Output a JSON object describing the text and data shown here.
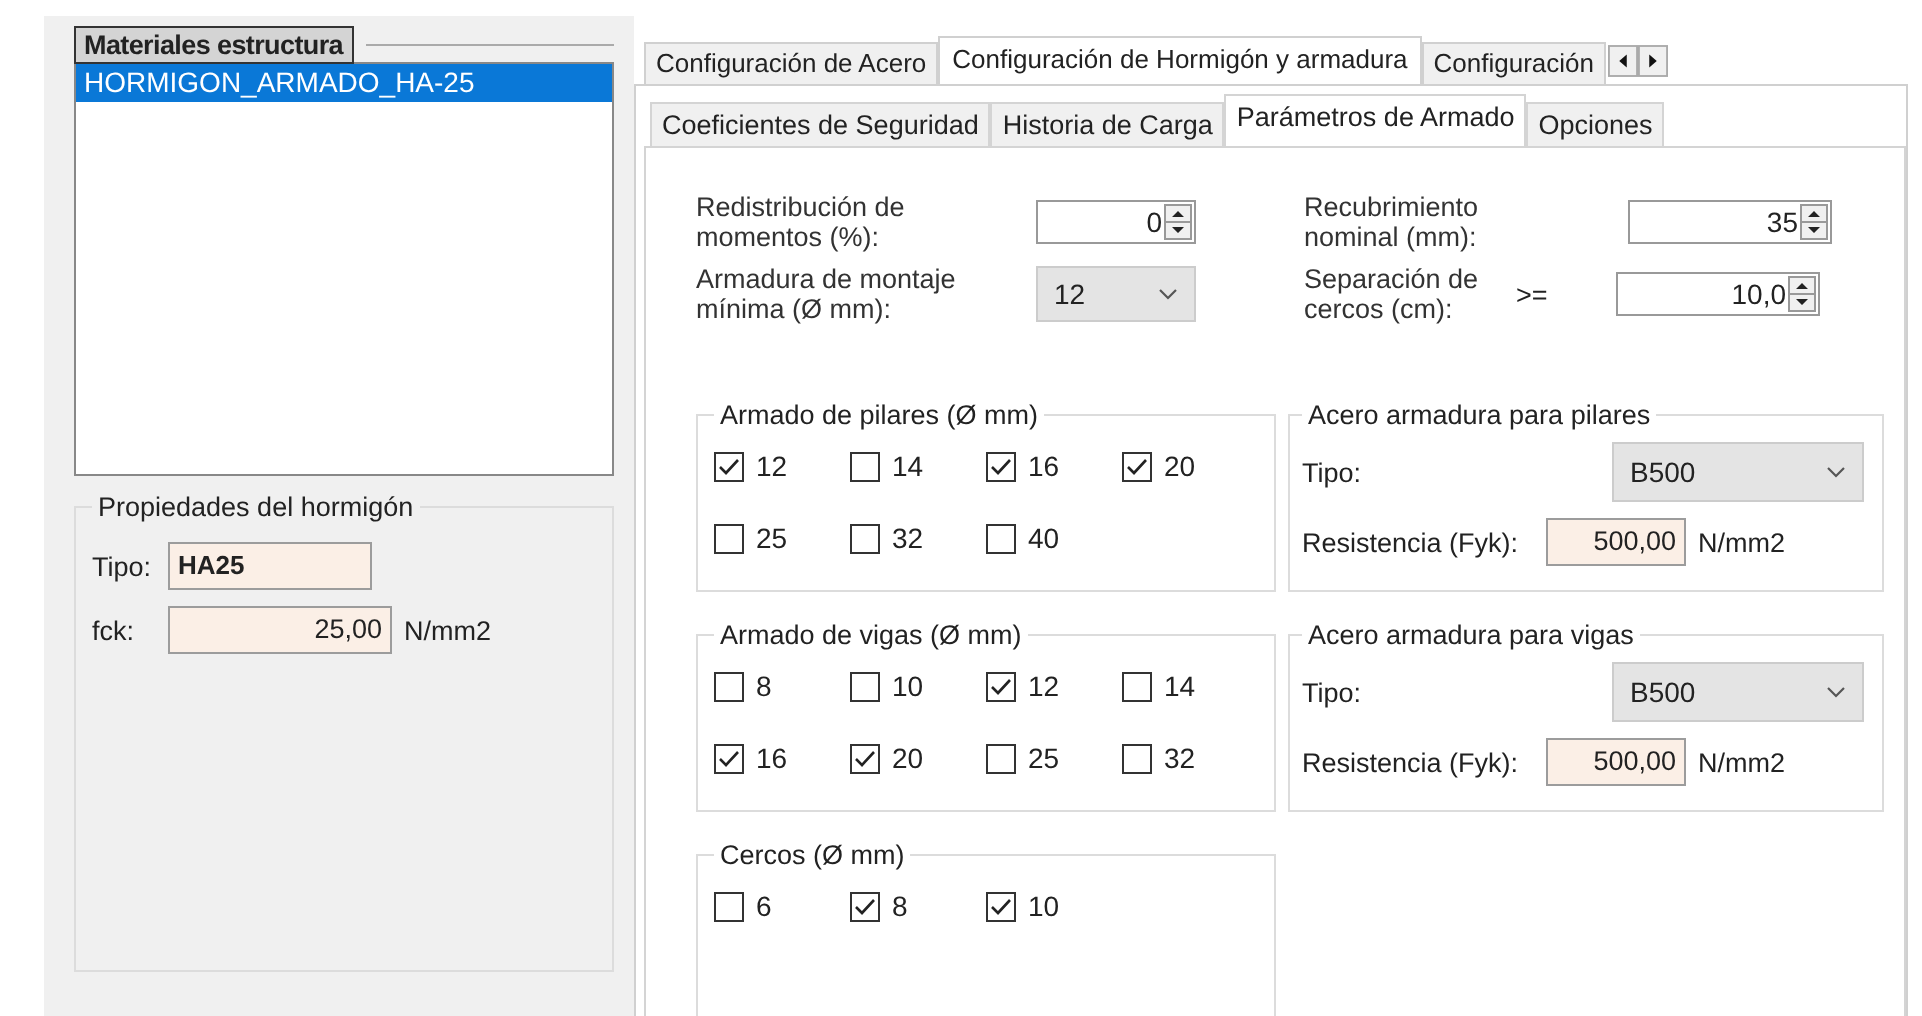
{
  "materials_panel": {
    "title": "Materiales estructura",
    "items": [
      {
        "label": "HORMIGON_ARMADO_HA-25",
        "selected": true
      }
    ],
    "properties": {
      "title": "Propiedades del hormigón",
      "tipo_label": "Tipo:",
      "tipo_value": "HA25",
      "fck_label": "fck:",
      "fck_value": "25,00",
      "fck_unit": "N/mm2"
    }
  },
  "outer_tabs": [
    {
      "label": "Configuración de Acero",
      "selected": false
    },
    {
      "label": "Configuración de Hormigón y armadura",
      "selected": true
    },
    {
      "label": "Configuración",
      "selected": false
    }
  ],
  "inner_tabs": [
    {
      "label": "Coeficientes de Seguridad",
      "selected": false
    },
    {
      "label": "Historia de Carga",
      "selected": false
    },
    {
      "label": "Parámetros de Armado",
      "selected": true
    },
    {
      "label": "Opciones",
      "selected": false
    }
  ],
  "fields": [
    {
      "kind": "spin",
      "label": "Redistribución de momentos (%):",
      "value": "0"
    },
    {
      "kind": "spin",
      "label": "Recubrimiento nominal (mm):",
      "value": "35"
    },
    {
      "kind": "combo",
      "label": "Armadura de montaje mínima (Ø mm):",
      "value": "12"
    },
    {
      "kind": "spin",
      "label": "Separación de cercos (cm):",
      "prefix": ">=",
      "value": "10,0"
    }
  ],
  "checkbox_groups": [
    {
      "title": "Armado de pilares  (Ø mm)",
      "options": [
        {
          "label": "12",
          "checked": true
        },
        {
          "label": "14",
          "checked": false
        },
        {
          "label": "16",
          "checked": true
        },
        {
          "label": "20",
          "checked": true
        },
        {
          "label": "25",
          "checked": false
        },
        {
          "label": "32",
          "checked": false
        },
        {
          "label": "40",
          "checked": false
        }
      ]
    },
    {
      "title": "Armado de vigas  (Ø mm)",
      "options": [
        {
          "label": "8",
          "checked": false
        },
        {
          "label": "10",
          "checked": false
        },
        {
          "label": "12",
          "checked": true
        },
        {
          "label": "14",
          "checked": false
        },
        {
          "label": "16",
          "checked": true
        },
        {
          "label": "20",
          "checked": true
        },
        {
          "label": "25",
          "checked": false
        },
        {
          "label": "32",
          "checked": false
        }
      ]
    },
    {
      "title": "Cercos  (Ø mm)",
      "options": [
        {
          "label": "6",
          "checked": false
        },
        {
          "label": "8",
          "checked": true
        },
        {
          "label": "10",
          "checked": true
        }
      ]
    }
  ],
  "steel_groups": [
    {
      "title": "Acero armadura para pilares",
      "tipo_label": "Tipo:",
      "tipo_value": "B500",
      "resistencia_label": "Resistencia (Fyk):",
      "resistencia_value": "500,00",
      "unit": "N/mm2"
    },
    {
      "title": "Acero armadura para vigas",
      "tipo_label": "Tipo:",
      "tipo_value": "B500",
      "resistencia_label": "Resistencia (Fyk):",
      "resistencia_value": "500,00",
      "unit": "N/mm2"
    }
  ]
}
